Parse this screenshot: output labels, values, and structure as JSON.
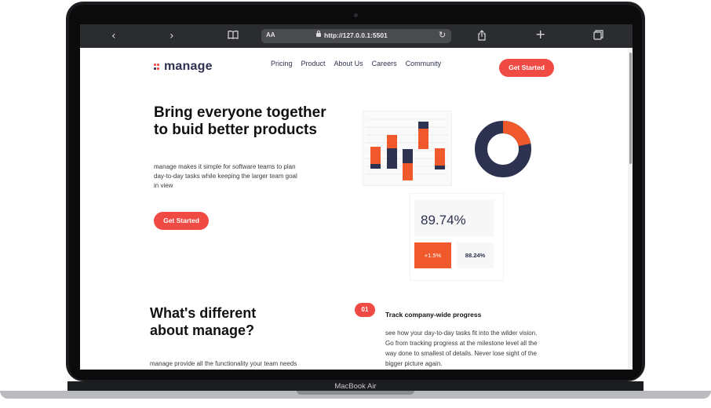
{
  "device": {
    "label": "MacBook Air"
  },
  "browser": {
    "aa_label": "AA",
    "url": "http://127.0.0.1:5501",
    "back_icon": "‹",
    "forward_icon": "›",
    "book_icon": "📖",
    "share_icon": "⇪",
    "plus_icon": "+",
    "tabs_icon": "❐",
    "reload_icon": "↻"
  },
  "site": {
    "logo": "manage",
    "nav": [
      "Pricing",
      "Product",
      "About Us",
      "Careers",
      "Community"
    ],
    "header_cta": "Get Started",
    "hero": {
      "title_line1": "Bring everyone together",
      "title_line2": "to buid better products",
      "desc_line1": "manage makes it simple for software teams to plan",
      "desc_line2": "day-to-day tasks while keeping the larger team goal",
      "desc_line3": "in view",
      "cta": "Get Started"
    },
    "stats": {
      "big": "89.74%",
      "change": "+1.5%",
      "secondary": "88.24%"
    },
    "diff": {
      "title_line1": "What's different",
      "title_line2": "about manage?",
      "desc": "manage provide all the functionality your team needs"
    },
    "feature": {
      "number": "01",
      "title": "Track company-wide progress",
      "desc_line1": "see how your day-to-day tasks fit into the wilder vision.",
      "desc_line2": "Go from tracking progress at the milestone level all the",
      "desc_line3": "way done to smallest of details. Never lose sight of the",
      "desc_line4": "bigger picture again."
    }
  },
  "colors": {
    "accent": "#f04a45",
    "orange": "#f0592c",
    "navy": "#2d3250"
  }
}
